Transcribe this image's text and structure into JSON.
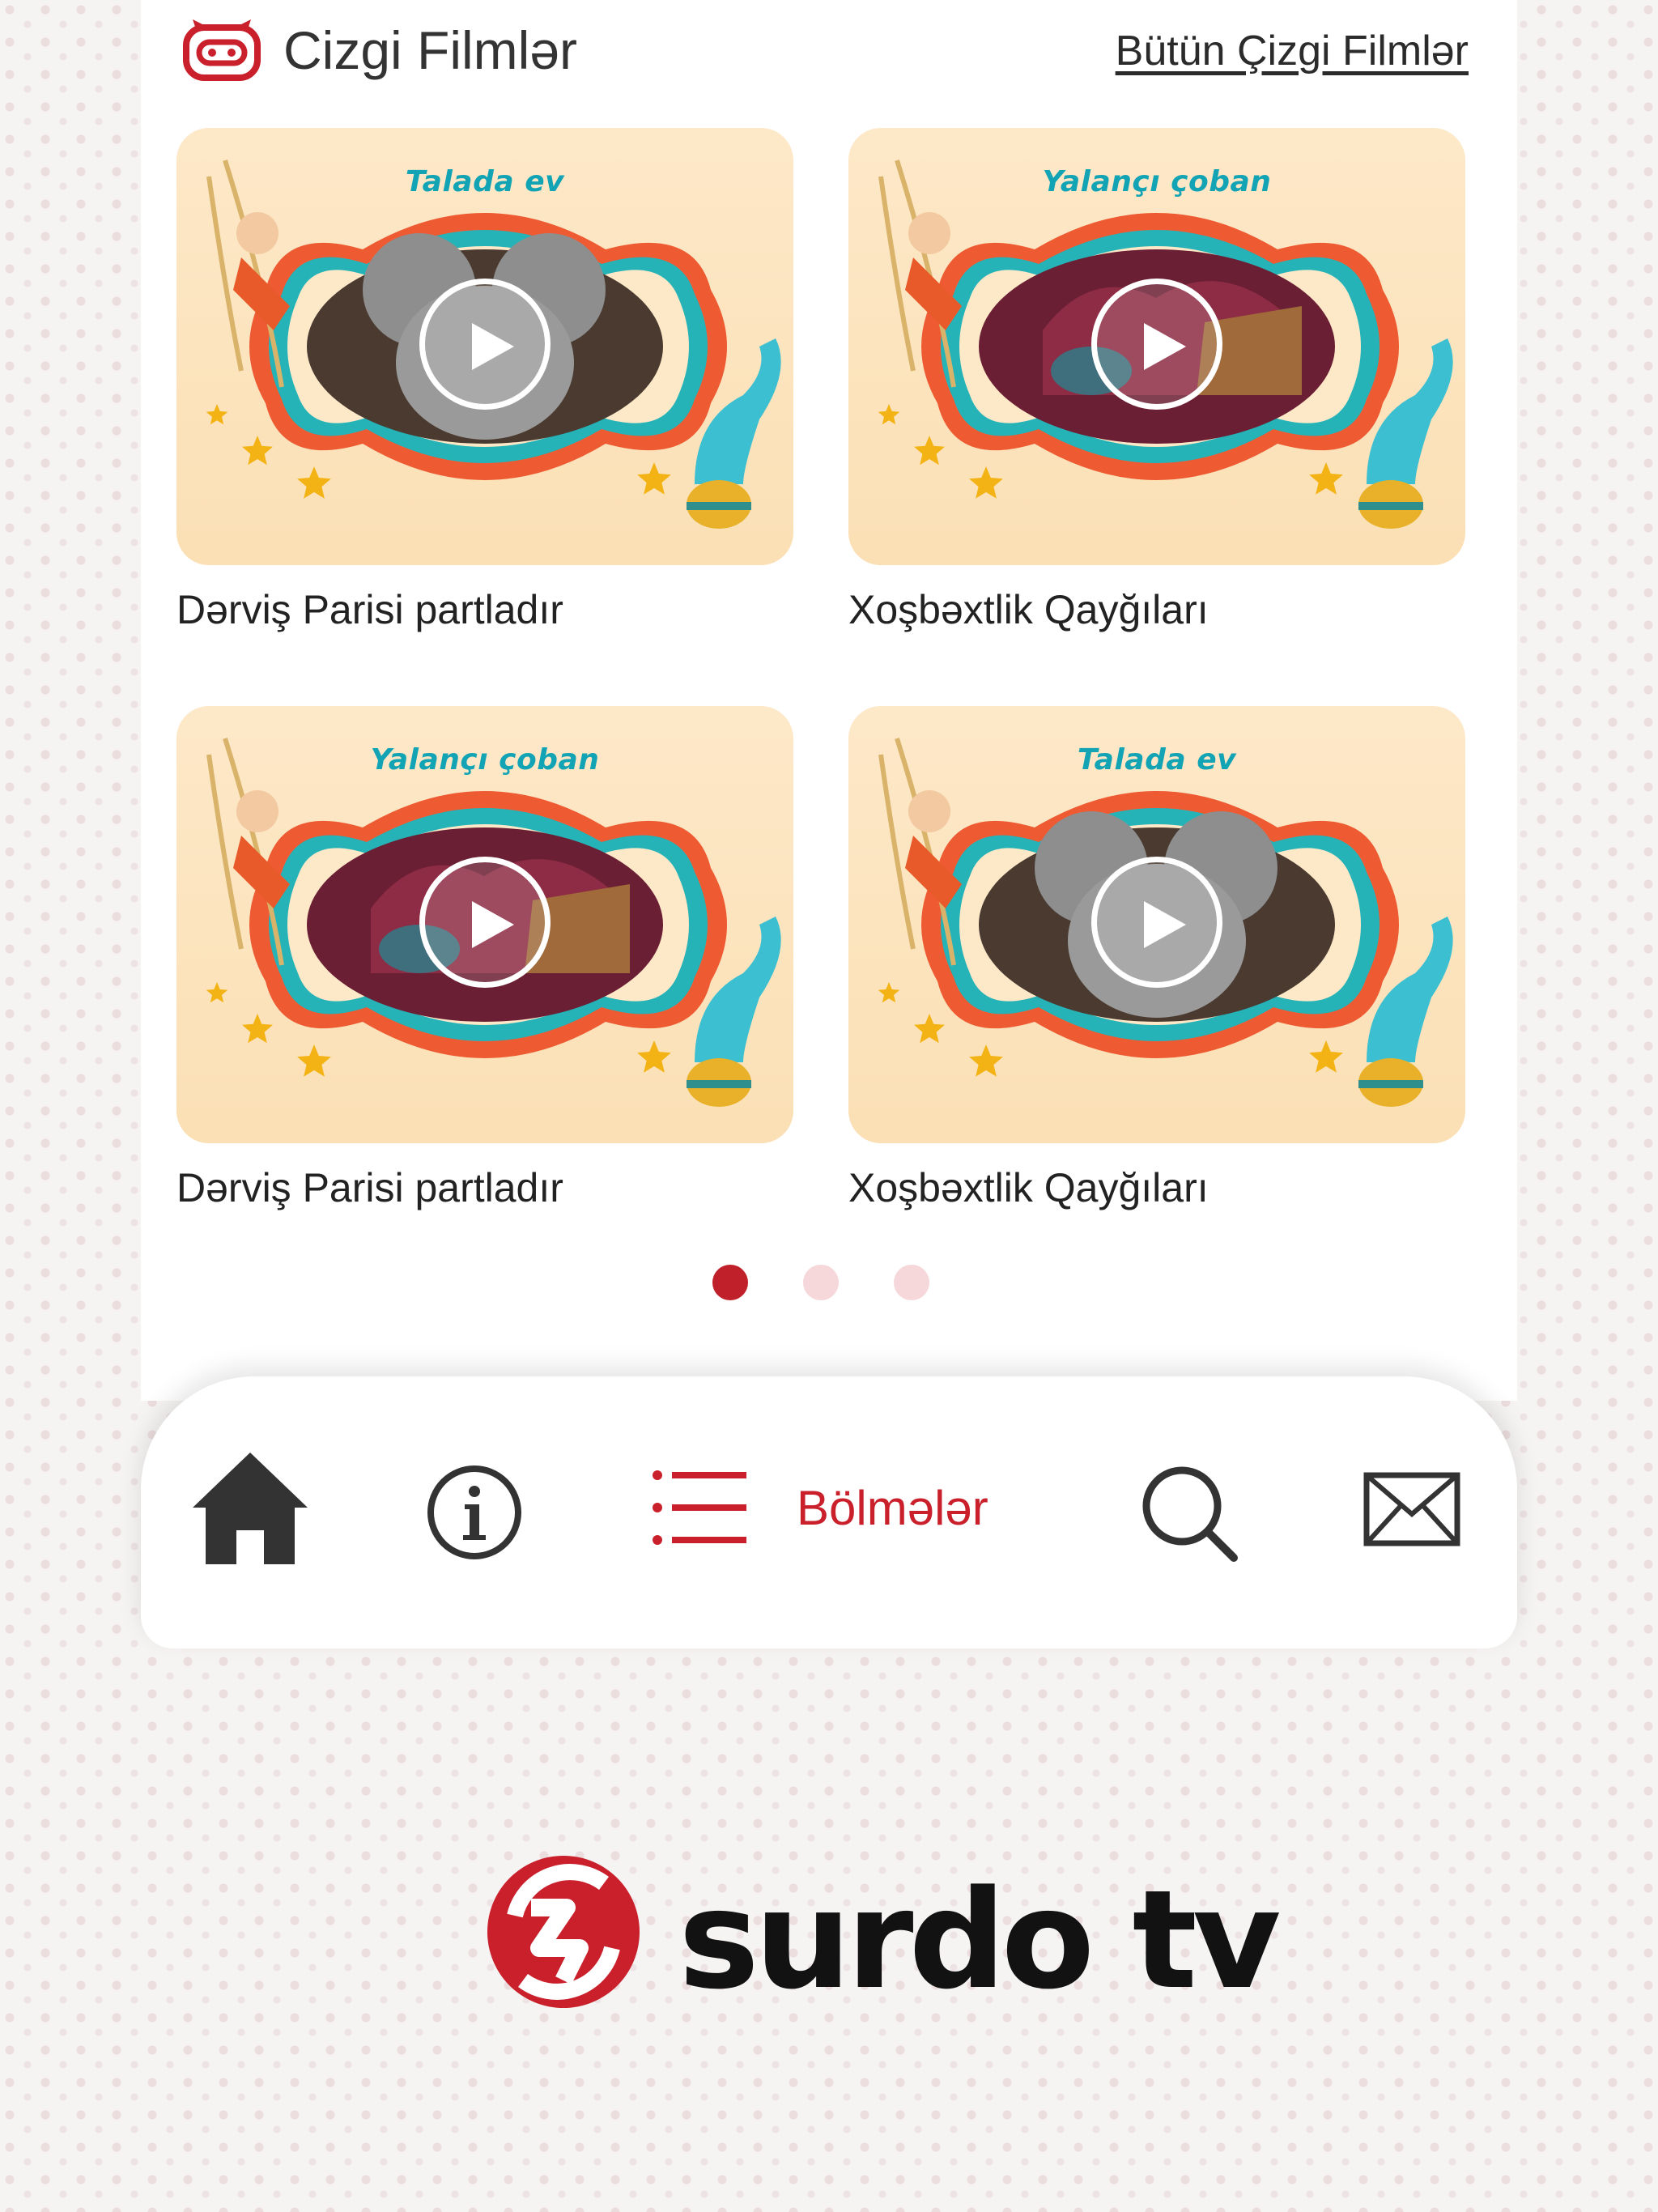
{
  "section": {
    "title": "Cizgi Filmlər",
    "all_link": "Bütün Çizgi Filmlər"
  },
  "cartoons": [
    {
      "thumb_title": "Talada ev",
      "caption": "Dərviş Parisi partladır",
      "scene": "mouse"
    },
    {
      "thumb_title": "Yalançı çoban",
      "caption": "Xoşbəxtlik Qayğıları",
      "scene": "shepherd"
    },
    {
      "thumb_title": "Yalançı çoban",
      "caption": "Dərviş Parisi partladır",
      "scene": "shepherd"
    },
    {
      "thumb_title": "Talada ev",
      "caption": "Xoşbəxtlik Qayğıları",
      "scene": "mouse"
    }
  ],
  "pagination": {
    "count": 3,
    "active_index": 0
  },
  "nav": {
    "items": [
      {
        "icon": "home-icon",
        "label": ""
      },
      {
        "icon": "info-icon",
        "label": ""
      },
      {
        "icon": "list-icon",
        "label": "Bölmələr",
        "active": true
      },
      {
        "icon": "search-icon",
        "label": ""
      },
      {
        "icon": "mail-icon",
        "label": ""
      }
    ]
  },
  "brand": {
    "name": "surdo tv"
  },
  "colors": {
    "accent": "#c9202c",
    "dot_active": "#c0202a",
    "dot_inactive": "#f6d8da",
    "thumb_bg": "#fde8c8",
    "thumb_title": "#12a4b5",
    "icon_dark": "#333333"
  }
}
